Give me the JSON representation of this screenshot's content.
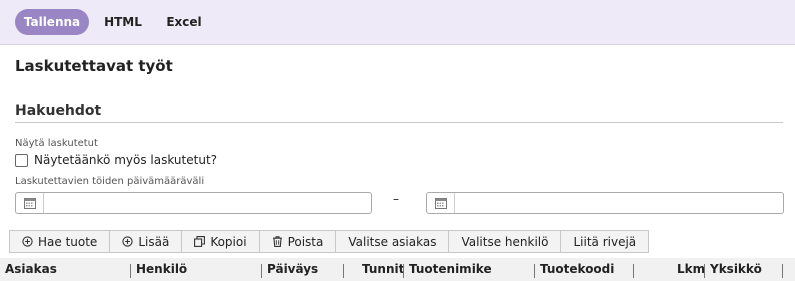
{
  "topbar": {
    "save_label": "Tallenna",
    "html_label": "HTML",
    "excel_label": "Excel",
    "accent_color": "#9a86c4"
  },
  "page": {
    "title": "Laskutettavat työt"
  },
  "search": {
    "section_title": "Hakuehdot",
    "show_invoiced_label": "Näytä laskutetut",
    "show_invoiced_checkbox_label": "Näytetäänkö myös laskutetut?",
    "show_invoiced_checked": false,
    "date_range_label": "Laskutettavien töiden päivämääräväli",
    "date_from": "",
    "date_to": "",
    "range_separator": "–"
  },
  "toolbar": {
    "buttons": [
      {
        "label": "Hae tuote",
        "icon": "plus-circle-icon"
      },
      {
        "label": "Lisää",
        "icon": "plus-circle-icon"
      },
      {
        "label": "Kopioi",
        "icon": "copy-icon"
      },
      {
        "label": "Poista",
        "icon": "trash-icon"
      },
      {
        "label": "Valitse asiakas",
        "icon": ""
      },
      {
        "label": "Valitse henkilö",
        "icon": ""
      },
      {
        "label": "Liitä rivejä",
        "icon": ""
      }
    ]
  },
  "table": {
    "columns": [
      "Asiakas",
      "Henkilö",
      "Päiväys",
      "Tunnit",
      "Tuotenimike",
      "Tuotekoodi",
      "Lkm",
      "Yksikkö"
    ]
  }
}
